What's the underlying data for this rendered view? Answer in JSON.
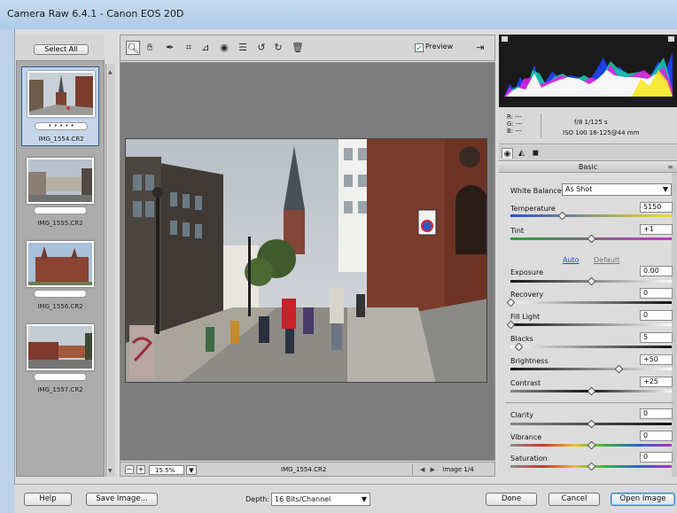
{
  "window": {
    "title": "Camera Raw 6.4.1  -  Canon EOS 20D"
  },
  "filmstrip": {
    "select_all": "Select All",
    "thumbs": [
      {
        "filename": "IMG_1554.CR2",
        "rating": "• • • • •",
        "selected": true
      },
      {
        "filename": "IMG_1555.CR2",
        "rating": "",
        "selected": false
      },
      {
        "filename": "IMG_1556.CR2",
        "rating": "",
        "selected": false
      },
      {
        "filename": "IMG_1557.CR2",
        "rating": "",
        "selected": false
      }
    ]
  },
  "toolbar": {
    "tools": [
      "zoom-icon",
      "hand-icon",
      "eyedropper-icon",
      "crop-icon",
      "straighten-icon",
      "red-eye-icon",
      "preferences-icon",
      "rotate-left-icon",
      "rotate-right-icon",
      "trash-icon"
    ],
    "preview_label": "Preview",
    "preview_checked": true
  },
  "status": {
    "zoom": "15.5%",
    "filename": "IMG_1554.CR2",
    "image_index": "Image 1/4"
  },
  "info": {
    "r": "R:  ---",
    "g": "G:  ---",
    "b": "B:  ---",
    "exposure_line": "f/8   1/125 s",
    "iso_line": "ISO 100   18-125@44 mm"
  },
  "panel": {
    "title": "Basic",
    "white_balance_label": "White Balance:",
    "white_balance_value": "As Shot",
    "auto_link": "Auto",
    "default_link": "Default",
    "sliders": [
      {
        "label": "Temperature",
        "value": "5150",
        "pos": 0.32
      },
      {
        "label": "Tint",
        "value": "+1",
        "pos": 0.5
      },
      {
        "label": "Exposure",
        "value": "0.00",
        "pos": 0.5
      },
      {
        "label": "Recovery",
        "value": "0",
        "pos": 0.0
      },
      {
        "label": "Fill Light",
        "value": "0",
        "pos": 0.0
      },
      {
        "label": "Blacks",
        "value": "5",
        "pos": 0.05
      },
      {
        "label": "Brightness",
        "value": "+50",
        "pos": 0.67
      },
      {
        "label": "Contrast",
        "value": "+25",
        "pos": 0.5
      },
      {
        "label": "Clarity",
        "value": "0",
        "pos": 0.5
      },
      {
        "label": "Vibrance",
        "value": "0",
        "pos": 0.5
      },
      {
        "label": "Saturation",
        "value": "0",
        "pos": 0.5
      }
    ]
  },
  "bottom": {
    "help": "Help",
    "save_image": "Save Image...",
    "depth_label": "Depth:",
    "depth_value": "16 Bits/Channel",
    "done": "Done",
    "cancel": "Cancel",
    "open_image": "Open Image"
  },
  "colors": {
    "accent": "#1f55a8",
    "title_bar": "#bcd2e8"
  }
}
